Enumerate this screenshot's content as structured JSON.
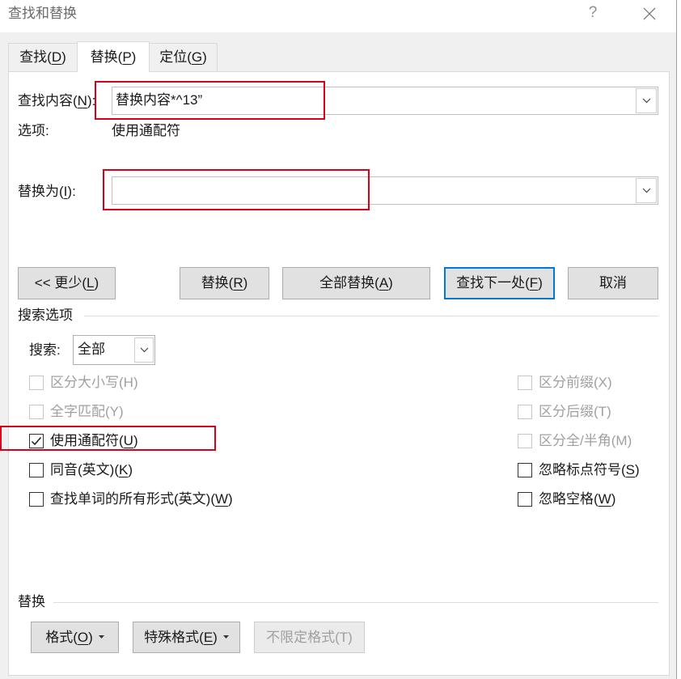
{
  "colors": {
    "dialog_bg": "#f0f0f0",
    "panel_bg": "#ffffff",
    "accent": "#0078d7",
    "annotation": "#d9001b",
    "disabled_text": "#a0a0a0",
    "button_bg": "#e1e1e1"
  },
  "icons": {
    "close": "close-icon",
    "dropdown": "chevron-down-icon",
    "check": "checkmark-icon",
    "menu_caret": "caret-down-icon"
  },
  "window": {
    "title": "查找和替换",
    "help": "?"
  },
  "tabs": [
    {
      "pre": "查找(",
      "key": "D",
      "post": ")",
      "selected": false
    },
    {
      "pre": "替换(",
      "key": "P",
      "post": ")",
      "selected": true
    },
    {
      "pre": "定位(",
      "key": "G",
      "post": ")",
      "selected": false
    }
  ],
  "find": {
    "label": {
      "pre": "查找内容(",
      "key": "N",
      "post": "):"
    },
    "value": "替换内容*^13”",
    "options_label": "选项:",
    "options_value": "使用通配符"
  },
  "replace": {
    "label": {
      "pre": "替换为(",
      "key": "I",
      "post": "):"
    },
    "value": ""
  },
  "actions": {
    "less": {
      "pre": "<< 更少(",
      "key": "L",
      "post": ")"
    },
    "replace": {
      "pre": "替换(",
      "key": "R",
      "post": ")"
    },
    "replace_all": {
      "pre": "全部替换(",
      "key": "A",
      "post": ")"
    },
    "find_next": {
      "pre": "查找下一处(",
      "key": "F",
      "post": ")",
      "default": true
    },
    "cancel": {
      "label": "取消"
    }
  },
  "search_options": {
    "heading": "搜索选项",
    "search_label": "搜索:",
    "search_value": "全部",
    "left": [
      {
        "pre": "区分大小写(",
        "key": "H",
        "post": ")",
        "checked": false,
        "disabled": true
      },
      {
        "pre": "全字匹配(",
        "key": "Y",
        "post": ")",
        "checked": false,
        "disabled": true
      },
      {
        "pre": "使用通配符(",
        "key": "U",
        "post": ")",
        "checked": true,
        "disabled": false
      },
      {
        "pre": "同音(英文)(",
        "key": "K",
        "post": ")",
        "checked": false,
        "disabled": false
      },
      {
        "pre": "查找单词的所有形式(英文)(",
        "key": "W",
        "post": ")",
        "checked": false,
        "disabled": false
      }
    ],
    "right": [
      {
        "pre": "区分前缀(",
        "key": "X",
        "post": ")",
        "checked": false,
        "disabled": true
      },
      {
        "pre": "区分后缀(",
        "key": "T",
        "post": ")",
        "checked": false,
        "disabled": true
      },
      {
        "pre": "区分全/半角(",
        "key": "M",
        "post": ")",
        "checked": false,
        "disabled": true
      },
      {
        "pre": "忽略标点符号(",
        "key": "S",
        "post": ")",
        "checked": false,
        "disabled": false
      },
      {
        "pre": "忽略空格(",
        "key": "W",
        "post": ")",
        "checked": false,
        "disabled": false
      }
    ]
  },
  "replace_section": {
    "heading": "替换",
    "format": {
      "pre": "格式(",
      "key": "O",
      "post": ")"
    },
    "special": {
      "pre": "特殊格式(",
      "key": "E",
      "post": ")"
    },
    "no_formatting": {
      "label": "不限定格式(T)",
      "disabled": true
    }
  }
}
